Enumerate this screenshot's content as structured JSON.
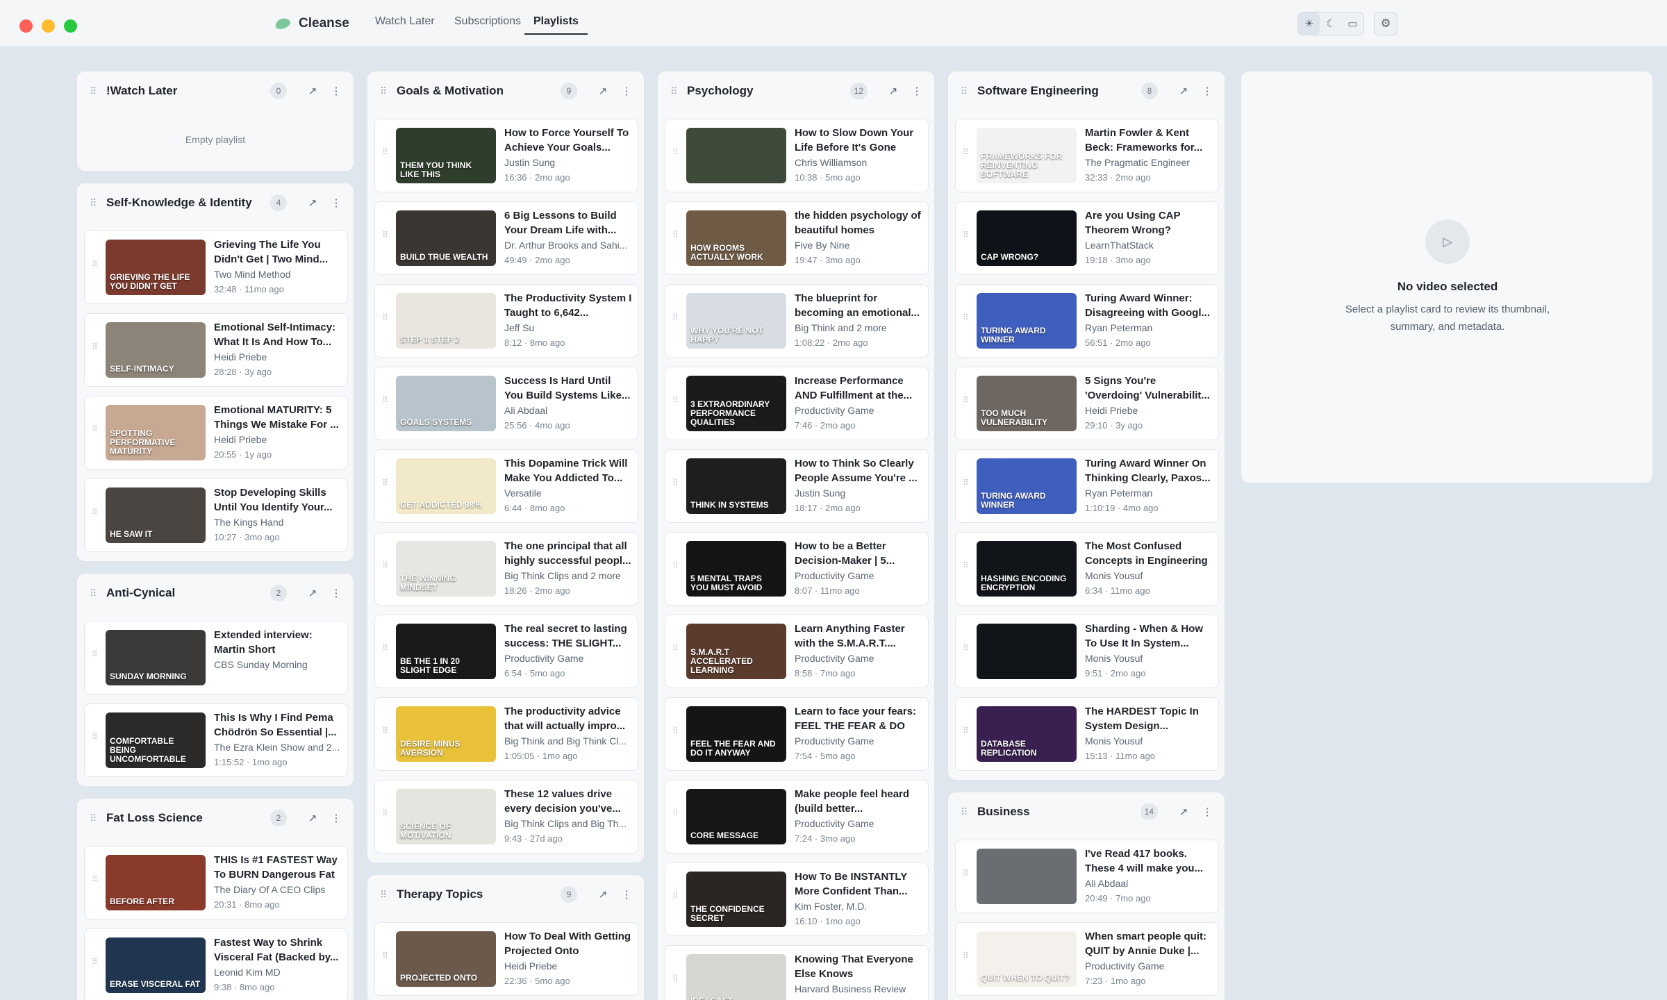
{
  "app": {
    "name": "Cleanse"
  },
  "nav": {
    "tabs": [
      {
        "label": "Watch Later"
      },
      {
        "label": "Subscriptions"
      },
      {
        "label": "Playlists"
      }
    ],
    "active": "Playlists"
  },
  "toolbar": {
    "theme_options": [
      "sun-icon",
      "moon-icon",
      "monitor-icon"
    ],
    "theme_selected": "sun-icon",
    "settings_icon": "gear-icon"
  },
  "colors": {
    "accent": "#2b2f35",
    "background": "#dfe6ee",
    "card": "#f6f8fa"
  },
  "columns": [
    {
      "cards": [
        {
          "title": "!Watch Later",
          "count": "0",
          "empty_text": "Empty playlist",
          "videos": []
        },
        {
          "title": "Self-Knowledge & Identity",
          "count": "4",
          "videos": [
            {
              "title": "Grieving The Life You Didn't Get | Two Mind...",
              "channel": "Two Mind Method",
              "meta": "32:48 · 11mo ago",
              "thumb_text": "Grieving the life you didn't get",
              "thumb_color": "#7a3b2e"
            },
            {
              "title": "Emotional Self-Intimacy: What It Is And How To...",
              "channel": "Heidi Priebe",
              "meta": "28:28 · 3y ago",
              "thumb_text": "Self-intimacy",
              "thumb_color": "#8d8479"
            },
            {
              "title": "Emotional MATURITY: 5 Things We Mistake For ...",
              "channel": "Heidi Priebe",
              "meta": "20:55 · 1y ago",
              "thumb_text": "Spotting performative maturity",
              "thumb_color": "#c7a993"
            },
            {
              "title": "Stop Developing Skills Until You Identify Your...",
              "channel": "The Kings Hand",
              "meta": "10:27 · 3mo ago",
              "thumb_text": "He saw it",
              "thumb_color": "#4a4541"
            }
          ]
        },
        {
          "title": "Anti-Cynical",
          "count": "2",
          "videos": [
            {
              "title": "Extended interview: Martin Short",
              "channel": "CBS Sunday Morning",
              "meta": "",
              "thumb_text": "Sunday Morning",
              "thumb_color": "#3b3a38"
            },
            {
              "title": "This Is Why I Find Pema Chödrön So Essential |...",
              "channel": "The Ezra Klein Show and 2...",
              "meta": "1:15:52 · 1mo ago",
              "thumb_text": "Comfortable being uncomfortable",
              "thumb_color": "#2c2a28"
            }
          ]
        },
        {
          "title": "Fat Loss Science",
          "count": "2",
          "videos": [
            {
              "title": "THIS Is #1 FASTEST Way To BURN Dangerous Fat",
              "channel": "The Diary Of A CEO Clips",
              "meta": "20:31 · 8mo ago",
              "thumb_text": "before after",
              "thumb_color": "#8a3a2a"
            },
            {
              "title": "Fastest Way to Shrink Visceral Fat (Backed by...",
              "channel": "Leonid Kim MD",
              "meta": "9:38 · 8mo ago",
              "thumb_text": "Erase visceral fat",
              "thumb_color": "#1f3550"
            }
          ]
        }
      ]
    },
    {
      "cards": [
        {
          "title": "Goals & Motivation",
          "count": "9",
          "videos": [
            {
              "title": "How to Force Yourself To Achieve Your Goals...",
              "channel": "Justin Sung",
              "meta": "16:36 · 2mo ago",
              "thumb_text": "Them you think like this",
              "thumb_color": "#2f3d2c"
            },
            {
              "title": "6 Big Lessons to Build Your Dream Life with...",
              "channel": "Dr. Arthur Brooks and Sahi...",
              "meta": "49:49 · 2mo ago",
              "thumb_text": "Build true wealth",
              "thumb_color": "#3a3632"
            },
            {
              "title": "The Productivity System I Taught to 6,642...",
              "channel": "Jeff Su",
              "meta": "8:12 · 8mo ago",
              "thumb_text": "Step 1 Step 2",
              "thumb_color": "#e9e6e0"
            },
            {
              "title": "Success Is Hard Until You Build Systems Like...",
              "channel": "Ali Abdaal",
              "meta": "25:56 · 4mo ago",
              "thumb_text": "Goals systems",
              "thumb_color": "#b8c4cc"
            },
            {
              "title": "This Dopamine Trick Will Make You Addicted To...",
              "channel": "Versatile",
              "meta": "6:44 · 8mo ago",
              "thumb_text": "get addicted 98%",
              "thumb_color": "#f2e9c8"
            },
            {
              "title": "The one principal that all highly successful peopl...",
              "channel": "Big Think Clips and 2 more",
              "meta": "18:26 · 2mo ago",
              "thumb_text": "The winning mindset",
              "thumb_color": "#e8e6e2"
            },
            {
              "title": "The real secret to lasting success: THE SLIGHT...",
              "channel": "Productivity Game",
              "meta": "6:54 · 5mo ago",
              "thumb_text": "Be the 1 in 20 slight edge",
              "thumb_color": "#1a1a1a"
            },
            {
              "title": "The productivity advice that will actually impro...",
              "channel": "Big Think and Big Think Cl...",
              "meta": "1:05:05 · 1mo ago",
              "thumb_text": "Desire minus aversion",
              "thumb_color": "#e9c23a"
            },
            {
              "title": "These 12 values drive every decision you've...",
              "channel": "Big Think Clips and Big Th...",
              "meta": "9:43 · 27d ago",
              "thumb_text": "Science of motivation",
              "thumb_color": "#e6e4df"
            }
          ]
        },
        {
          "title": "Therapy Topics",
          "count": "9",
          "videos": [
            {
              "title": "How To Deal With Getting Projected Onto",
              "channel": "Heidi Priebe",
              "meta": "22:36 · 5mo ago",
              "thumb_text": "Projected onto",
              "thumb_color": "#6b5a4b"
            }
          ]
        }
      ]
    },
    {
      "cards": [
        {
          "title": "Psychology",
          "count": "12",
          "videos": [
            {
              "title": "How to Slow Down Your Life Before It's Gone",
              "channel": "Chris Williamson",
              "meta": "10:38 · 5mo ago",
              "thumb_text": "",
              "thumb_color": "#3e4a3a"
            },
            {
              "title": "the hidden psychology of beautiful homes",
              "channel": "Five By Nine",
              "meta": "19:47 · 3mo ago",
              "thumb_text": "how rooms actually work",
              "thumb_color": "#6e5a45"
            },
            {
              "title": "The blueprint for becoming an emotional...",
              "channel": "Big Think and 2 more",
              "meta": "1:08:22 · 2mo ago",
              "thumb_text": "Why you're not happy",
              "thumb_color": "#d7dde2"
            },
            {
              "title": "Increase Performance AND Fulfillment at the...",
              "channel": "Productivity Game",
              "meta": "7:46 · 2mo ago",
              "thumb_text": "3 extraordinary performance qualities",
              "thumb_color": "#1b1b1b"
            },
            {
              "title": "How to Think So Clearly People Assume You're ...",
              "channel": "Justin Sung",
              "meta": "18:17 · 2mo ago",
              "thumb_text": "Think in systems",
              "thumb_color": "#1e1e1e"
            },
            {
              "title": "How to be a Better Decision-Maker | 5...",
              "channel": "Productivity Game",
              "meta": "8:07 · 11mo ago",
              "thumb_text": "5 mental traps you must avoid",
              "thumb_color": "#141414"
            },
            {
              "title": "Learn Anything Faster with the S.M.A.R.T....",
              "channel": "Productivity Game",
              "meta": "8:58 · 7mo ago",
              "thumb_text": "S.M.A.R.T accelerated learning",
              "thumb_color": "#5a3b2c"
            },
            {
              "title": "Learn to face your fears: FEEL THE FEAR & DO IT...",
              "channel": "Productivity Game",
              "meta": "7:54 · 5mo ago",
              "thumb_text": "Feel the fear and do it anyway",
              "thumb_color": "#151515"
            },
            {
              "title": "Make people feel heard (build better...",
              "channel": "Productivity Game",
              "meta": "7:24 · 3mo ago",
              "thumb_text": "Core message",
              "thumb_color": "#161616"
            },
            {
              "title": "How To Be INSTANTLY More Confident Than...",
              "channel": "Kim Foster, M.D.",
              "meta": "16:10 · 1mo ago",
              "thumb_text": "The confidence secret",
              "thumb_color": "#2b2623"
            },
            {
              "title": "Knowing That Everyone Else Knows",
              "channel": "Harvard Business Review",
              "meta": "",
              "thumb_text": "IdeaCast",
              "thumb_color": "#d8d6d2"
            }
          ]
        }
      ]
    },
    {
      "cards": [
        {
          "title": "Software Engineering",
          "count": "8",
          "videos": [
            {
              "title": "Martin Fowler & Kent Beck: Frameworks for...",
              "channel": "The Pragmatic Engineer",
              "meta": "32:33 · 2mo ago",
              "thumb_text": "Frameworks for reinventing software",
              "thumb_color": "#f2f2f2"
            },
            {
              "title": "Are you Using CAP Theorem Wrong?",
              "channel": "LearnThatStack",
              "meta": "19:18 · 3mo ago",
              "thumb_text": "CAP wrong?",
              "thumb_color": "#0f1218"
            },
            {
              "title": "Turing Award Winner: Disagreeing with Googl...",
              "channel": "Ryan Peterman",
              "meta": "56:51 · 2mo ago",
              "thumb_text": "Turing Award Winner",
              "thumb_color": "#3f5fbf"
            },
            {
              "title": "5 Signs You're 'Overdoing' Vulnerabilit...",
              "channel": "Heidi Priebe",
              "meta": "29:10 · 3y ago",
              "thumb_text": "Too much vulnerability",
              "thumb_color": "#6e6660"
            },
            {
              "title": "Turing Award Winner On Thinking Clearly, Paxos...",
              "channel": "Ryan Peterman",
              "meta": "1:10:19 · 4mo ago",
              "thumb_text": "Turing Award Winner",
              "thumb_color": "#3f5fbf"
            },
            {
              "title": "The Most Confused Concepts in Engineering",
              "channel": "Monis Yousuf",
              "meta": "6:34 · 11mo ago",
              "thumb_text": "Hashing Encoding Encryption",
              "thumb_color": "#111418"
            },
            {
              "title": "Sharding - When & How To Use It In System...",
              "channel": "Monis Yousuf",
              "meta": "9:51 · 2mo ago",
              "thumb_text": "",
              "thumb_color": "#111418"
            },
            {
              "title": "The HARDEST Topic In System Design...",
              "channel": "Monis Yousuf",
              "meta": "15:13 · 11mo ago",
              "thumb_text": "Database replication",
              "thumb_color": "#3a2050"
            }
          ]
        },
        {
          "title": "Business",
          "count": "14",
          "videos": [
            {
              "title": "I've Read 417 books. These 4 will make you...",
              "channel": "Ali Abdaal",
              "meta": "20:49 · 7mo ago",
              "thumb_text": "",
              "thumb_color": "#6a6e72"
            },
            {
              "title": "When smart people quit: QUIT by Annie Duke |...",
              "channel": "Productivity Game",
              "meta": "7:23 · 1mo ago",
              "thumb_text": "Quit when to quit?",
              "thumb_color": "#f4f1ec"
            }
          ]
        }
      ]
    }
  ],
  "detail": {
    "title": "No video selected",
    "body": "Select a playlist card to review its thumbnail, summary, and metadata."
  }
}
